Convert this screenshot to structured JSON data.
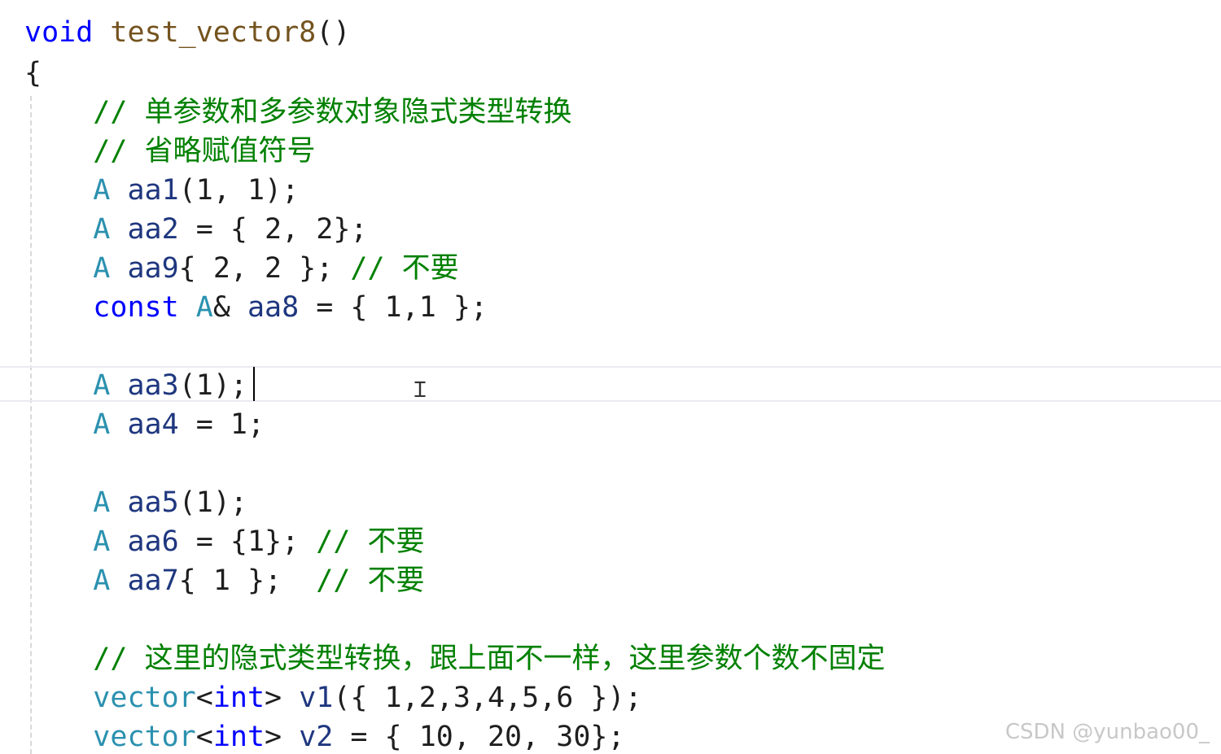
{
  "code": {
    "fn_keyword": "void",
    "fn_name": "test_vector8",
    "fn_parens": "()",
    "open_brace": "{",
    "comment1_slashes": "//",
    "comment1_text": "单参数和多参数对象隐式类型转换",
    "comment2_slashes": "//",
    "comment2_text": "省略赋值符号",
    "type_A": "A",
    "aa1_name": "aa1",
    "aa1_rest": "(1, 1);",
    "aa2_name": "aa2",
    "aa2_rest": " = { 2, 2};",
    "aa9_name": "aa9",
    "aa9_rest": "{ 2, 2 }; ",
    "aa9_comment_slashes": "//",
    "aa9_comment_text": "不要",
    "const_keyword": "const",
    "aa8_amp": "&",
    "aa8_name": "aa8",
    "aa8_rest": " = { 1,1 };",
    "aa3_name": "aa3",
    "aa3_rest": "(1);",
    "aa4_name": "aa4",
    "aa4_rest": " = 1;",
    "aa5_name": "aa5",
    "aa5_rest": "(1);",
    "aa6_name": "aa6",
    "aa6_rest": " = {1}; ",
    "aa6_comment_slashes": "//",
    "aa6_comment_text": "不要",
    "aa7_name": "aa7",
    "aa7_rest": "{ 1 };  ",
    "aa7_comment_slashes": "//",
    "aa7_comment_text": "不要",
    "comment3_slashes": "//",
    "comment3_text": "这里的隐式类型转换，跟上面不一样，这里参数个数不固定",
    "vector_type": "vector",
    "lt": "<",
    "int_keyword": "int",
    "gt": ">",
    "v1_name": "v1",
    "v1_rest": "({ 1,2,3,4,5,6 });",
    "v2_name": "v2",
    "v2_rest": " = { 10, 20, 30};"
  },
  "watermark": "CSDN @yunbao00_",
  "colors": {
    "keyword": "#0000ff",
    "type": "#2b91af",
    "function": "#74531f",
    "comment": "#008000",
    "identifier": "#1f377f"
  }
}
